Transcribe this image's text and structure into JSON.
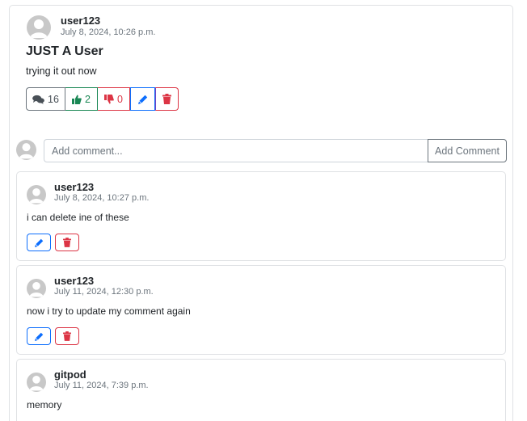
{
  "post": {
    "username": "user123",
    "date": "July 8, 2024, 10:26 p.m.",
    "title": "JUST A User",
    "body": "trying it out now",
    "comment_count": "16",
    "like_count": "2",
    "dislike_count": "0"
  },
  "add_comment": {
    "placeholder": "Add comment...",
    "button_label": "Add Comment"
  },
  "comments": [
    {
      "username": "user123",
      "date": "July 8, 2024, 10:27 p.m.",
      "text": "i can delete ine of these"
    },
    {
      "username": "user123",
      "date": "July 11, 2024, 12:30 p.m.",
      "text": "now i try to update my comment again"
    },
    {
      "username": "gitpod",
      "date": "July 11, 2024, 7:39 p.m.",
      "text": "memory"
    }
  ],
  "colors": {
    "edit": "#0d6efd",
    "delete": "#dc3545",
    "like": "#198754",
    "secondary": "#6c757d",
    "avatar": "#c8c8c8"
  },
  "icons": [
    "comments-icon",
    "thumbs-up-icon",
    "thumbs-down-icon",
    "pencil-icon",
    "trash-icon",
    "user-avatar-icon"
  ]
}
